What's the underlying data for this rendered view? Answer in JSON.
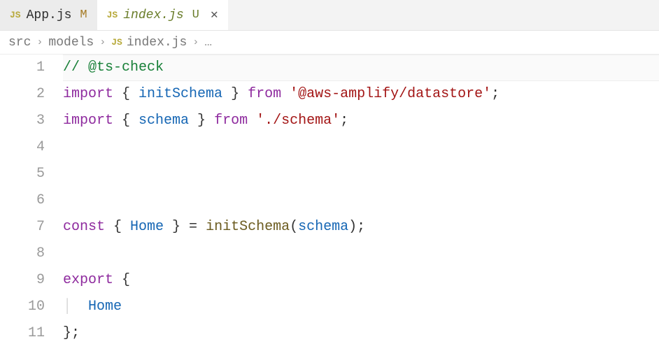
{
  "tabs": [
    {
      "icon": "JS",
      "name": "App.js",
      "git": "M",
      "active": false
    },
    {
      "icon": "JS",
      "name": "index.js",
      "git": "U",
      "active": true
    }
  ],
  "breadcrumbs": {
    "items": [
      "src",
      "models"
    ],
    "file_icon": "JS",
    "file": "index.js",
    "tail": "…"
  },
  "code": {
    "lines": [
      {
        "n": 1,
        "tokens": [
          {
            "t": "// @ts-check",
            "c": "comment"
          }
        ]
      },
      {
        "n": 2,
        "tokens": [
          {
            "t": "import ",
            "c": "keyword"
          },
          {
            "t": "{ ",
            "c": "punct"
          },
          {
            "t": "initSchema",
            "c": "ident"
          },
          {
            "t": " }",
            "c": "punct"
          },
          {
            "t": " from ",
            "c": "keyword"
          },
          {
            "t": "'@aws-amplify/datastore'",
            "c": "string"
          },
          {
            "t": ";",
            "c": "punct"
          }
        ]
      },
      {
        "n": 3,
        "tokens": [
          {
            "t": "import ",
            "c": "keyword"
          },
          {
            "t": "{ ",
            "c": "punct"
          },
          {
            "t": "schema",
            "c": "ident"
          },
          {
            "t": " }",
            "c": "punct"
          },
          {
            "t": " from ",
            "c": "keyword"
          },
          {
            "t": "'./schema'",
            "c": "string"
          },
          {
            "t": ";",
            "c": "punct"
          }
        ]
      },
      {
        "n": 4,
        "tokens": []
      },
      {
        "n": 5,
        "tokens": []
      },
      {
        "n": 6,
        "tokens": []
      },
      {
        "n": 7,
        "tokens": [
          {
            "t": "const ",
            "c": "keyword"
          },
          {
            "t": "{ ",
            "c": "punct"
          },
          {
            "t": "Home",
            "c": "ident"
          },
          {
            "t": " } = ",
            "c": "punct"
          },
          {
            "t": "initSchema",
            "c": "func"
          },
          {
            "t": "(",
            "c": "punct"
          },
          {
            "t": "schema",
            "c": "ident"
          },
          {
            "t": ");",
            "c": "punct"
          }
        ]
      },
      {
        "n": 8,
        "tokens": []
      },
      {
        "n": 9,
        "tokens": [
          {
            "t": "export ",
            "c": "keyword"
          },
          {
            "t": "{",
            "c": "punct"
          }
        ]
      },
      {
        "n": 10,
        "tokens": [
          {
            "t": "  ",
            "c": "plain"
          },
          {
            "t": "Home",
            "c": "ident"
          }
        ],
        "guide": true
      },
      {
        "n": 11,
        "tokens": [
          {
            "t": "};",
            "c": "punct"
          }
        ]
      }
    ],
    "current_line": 1
  }
}
